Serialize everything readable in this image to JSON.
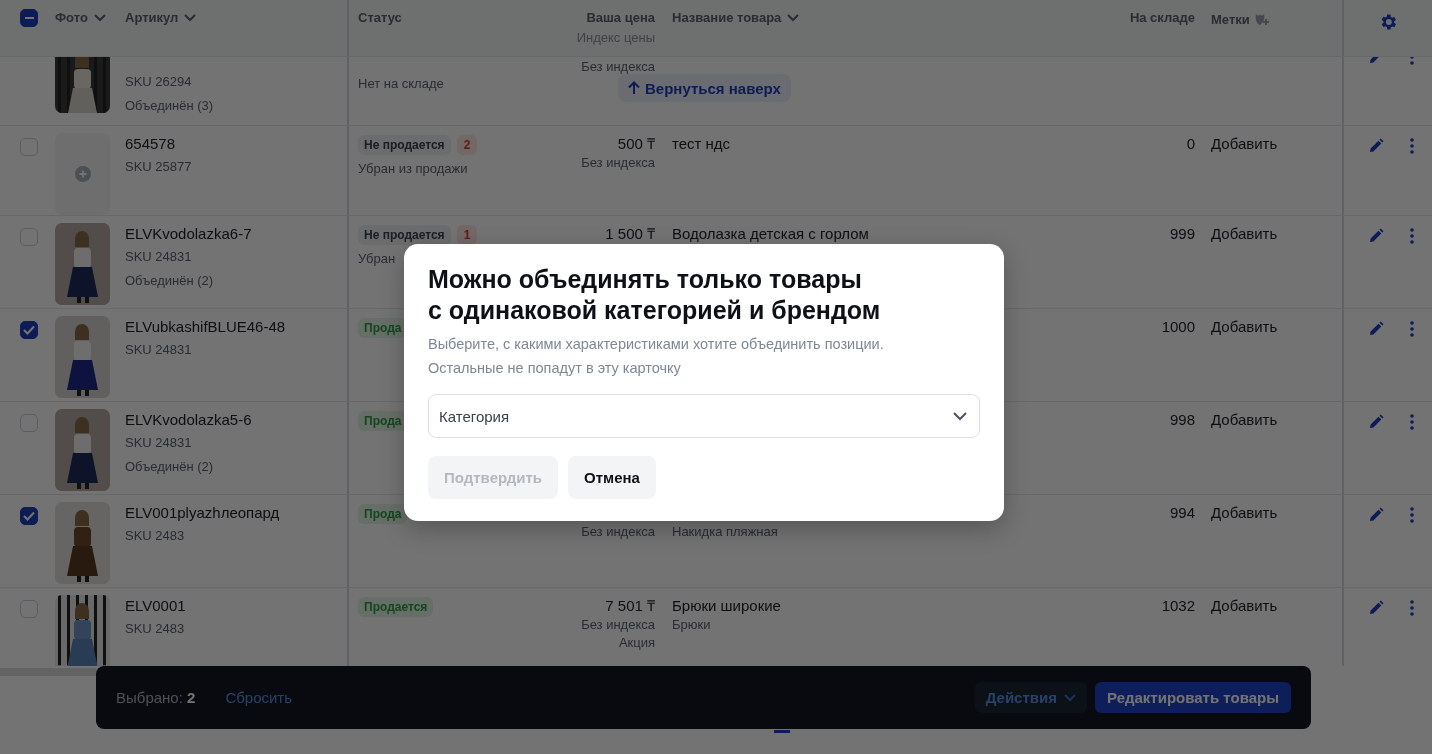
{
  "header": {
    "select_all": {
      "indeterminate": true
    },
    "photo": "Фото",
    "article": "Артикул",
    "status": "Статус",
    "price": "Ваша цена",
    "price_index": "Индекс цены",
    "name": "Название товара",
    "stock": "На складе",
    "labels": "Метки"
  },
  "rows": [
    {
      "sku": "SKU 26294",
      "merged": "Объединён (3)",
      "status": {
        "detail": "Нет на складе"
      },
      "price": {
        "index": "Без индекса"
      }
    },
    {
      "checked": false,
      "photo": {
        "kind": "placeholder"
      },
      "article": "654578",
      "sku": "SKU 25877",
      "status": {
        "kind": "not_selling",
        "label": "Не продается",
        "count": "2",
        "detail": "Убран из продажи"
      },
      "price": {
        "value": "500 ₸",
        "index": "Без индекса"
      },
      "name": {
        "title": "тест ндс"
      },
      "stock": "0",
      "labels": "Добавить"
    },
    {
      "checked": false,
      "article": "ELVKvodolazka6-7",
      "sku": "SKU 24831",
      "merged": "Объединён (2)",
      "status": {
        "kind": "not_selling",
        "label": "Не продается",
        "count": "1",
        "detail": "Убран"
      },
      "price": {
        "value": "1 500 ₸"
      },
      "name": {
        "title": "Водолазка детская с горлом"
      },
      "stock": "999",
      "labels": "Добавить"
    },
    {
      "checked": true,
      "article": "ELVubkashifBLUE46-48",
      "sku": "SKU 24831",
      "status": {
        "kind": "selling",
        "label": "Прода"
      },
      "stock": "1000",
      "labels": "Добавить"
    },
    {
      "checked": false,
      "article": "ELVKvodolazka5-6",
      "sku": "SKU 24831",
      "merged": "Объединён (2)",
      "status": {
        "kind": "selling",
        "label": "Прода"
      },
      "stock": "998",
      "labels": "Добавить"
    },
    {
      "checked": true,
      "article": "ELV001plyazhлеопард",
      "sku": "SKU 2483",
      "status": {
        "kind": "selling",
        "label": "Прода"
      },
      "price": {
        "index": "Без индекса"
      },
      "name": {
        "subtitle": "Накидка пляжная"
      },
      "stock": "994",
      "labels": "Добавить"
    },
    {
      "checked": false,
      "article": "ELV0001",
      "sku": "SKU 2483",
      "status": {
        "kind": "selling",
        "label": "Продается"
      },
      "price": {
        "value": "7 501 ₸",
        "index": "Без индекса",
        "promo": "Акция"
      },
      "name": {
        "title": "Брюки широкие",
        "subtitle": "Брюки"
      },
      "stock": "1032",
      "labels": "Добавить"
    }
  ],
  "back_to_top": "Вернуться наверх",
  "bottom_bar": {
    "selected_label": "Выбрано:",
    "selected_count": "2",
    "reset": "Сбросить",
    "actions": "Действия",
    "edit": "Редактировать товары"
  },
  "modal": {
    "title": "Можно объединять только товары с одинаковой категорией и брендом",
    "description": "Выберите, с какими характеристиками хотите объединить позиции. Остальные не попадут в эту карточку",
    "select": {
      "value": "Категория"
    },
    "confirm": {
      "label": "Подтвердить",
      "disabled": true
    },
    "cancel": "Отмена"
  }
}
